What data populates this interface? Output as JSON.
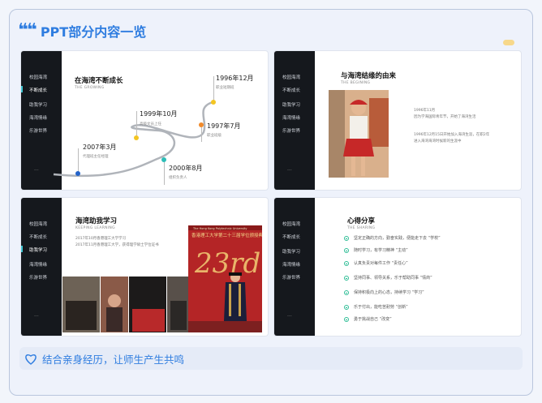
{
  "header": {
    "title": "PPT部分内容一览"
  },
  "nav": [
    "校园海湾",
    "不断成长",
    "助我学习",
    "海湾情缘",
    "乐游世界"
  ],
  "slide1": {
    "title": "在海湾不断成长",
    "subtitle": "THE GROWING",
    "timeline": [
      {
        "year": "1996年12月",
        "cap": "职业短期班"
      },
      {
        "year": "1999年10月",
        "cap": "高级文员上任"
      },
      {
        "year": "1997年7月",
        "cap": "职业班级"
      },
      {
        "year": "2007年3月",
        "cap": "代理班主任经理"
      },
      {
        "year": "2000年8月",
        "cap": "组织负责人"
      }
    ]
  },
  "slide2": {
    "title": "与海湾结缘的由来",
    "subtitle": "THE BEGINING",
    "nav": [
      "校园海湾",
      "不断成长",
      "助我学习",
      "海湾情缘",
      "乐游世界"
    ],
    "p1": [
      "1996年11月",
      "因为学海国际青年节，开始了海湾生活"
    ],
    "p2": [
      "1996年12月15日开始加入海湾生涯，在职2年",
      "进入海湾海湾时候新的生涯中"
    ]
  },
  "slide3": {
    "title": "海湾助我学习",
    "subtitle": "KEEPING LEARNING",
    "nav": [
      "校园海湾",
      "不断成长",
      "助我学习",
      "海湾情缘",
      "乐游世界"
    ],
    "p": [
      "2017年10月香港理工大学学习",
      "2017年11月香港理工大学，获得理学硕士学位证书"
    ],
    "banner": "The Hong Kong Polytechnic University",
    "banner2": "香港理工大学第二十三届学位颁授典礼",
    "grad": "23rd"
  },
  "slide4": {
    "title": "心得分享",
    "subtitle": "THE SHARING",
    "nav": [
      "校园海湾",
      "不断成长",
      "助我学习",
      "海湾情缘",
      "乐游世界"
    ],
    "bullets": [
      "坚定正确的方向，勤奋实践，便能走下去 “学校”",
      "随时学习，有学习精神 “主动”",
      "认真负责对每件工作 “责任心”",
      "坚持同事、领导关系，乐于帮助同事 “情商”",
      "保持积极向上的心态，持续学习 “学习”",
      "乐于付出，能吃苦耐劳 “创新”",
      "勇于挑战自己 “改变”"
    ]
  },
  "footer": {
    "text": "结合亲身经历，让师生产生共鸣"
  }
}
